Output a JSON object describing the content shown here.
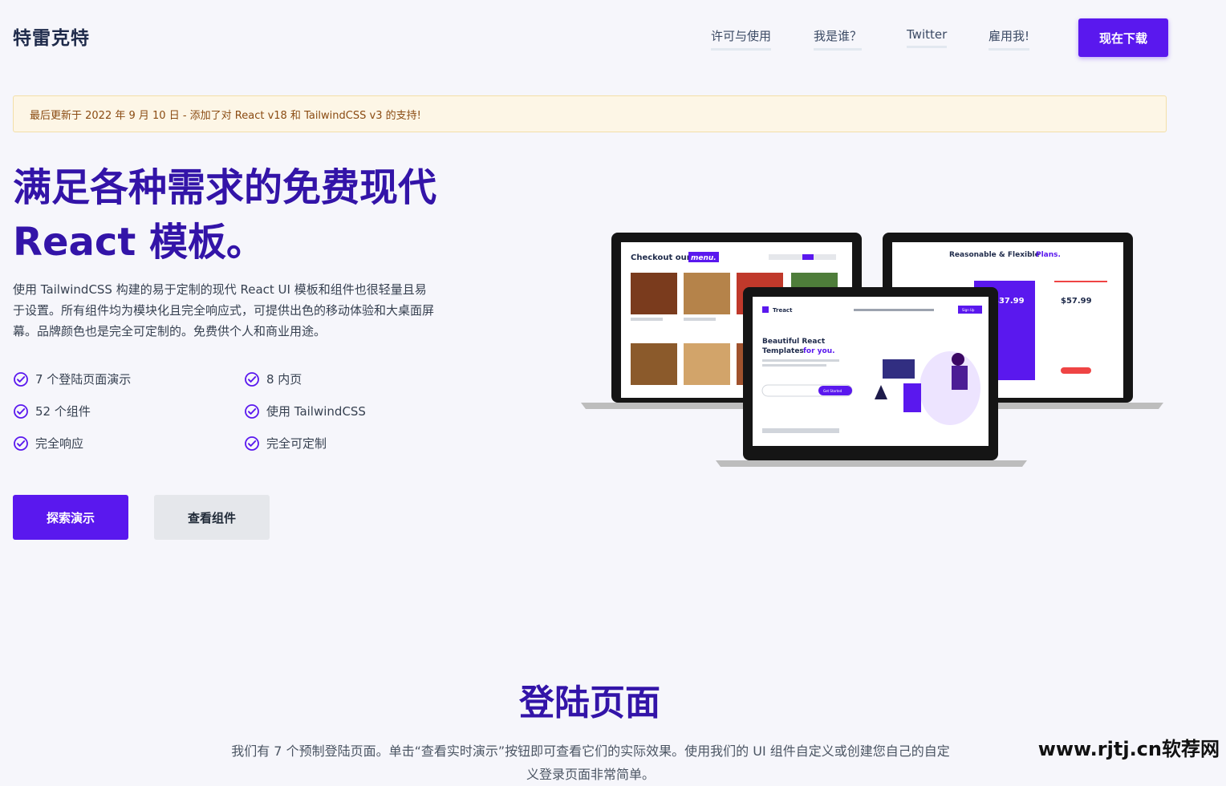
{
  "brand": "特雷克特",
  "nav": {
    "links": [
      "许可与使用",
      "我是谁？",
      "Twitter",
      "雇用我!"
    ],
    "cta": "现在下载"
  },
  "notice": "最后更新于 2022 年 9 月 10 日 - 添加了对 React v18 和 TailwindCSS v3 的支持!",
  "hero": {
    "title_line1": "满足各种需求的免费现代",
    "title_line2": "React 模板。",
    "description": "使用 TailwindCSS 构建的易于定制的现代 React UI 模板和组件也很轻量且易于设置。所有组件均为模块化且完全响应式，可提供出色的移动体验和大桌面屏幕。品牌颜色也是完全可定制的。免费供个人和商业用途。",
    "features": [
      "7 个登陆页面演示",
      "8 内页",
      "52 个组件",
      "使用 TailwindCSS",
      "完全响应",
      "完全可定制"
    ],
    "primary_button": "探索演示",
    "secondary_button": "查看组件"
  },
  "mockups": {
    "menu_title": "Checkout our",
    "menu_highlight": "menu.",
    "plans_title": "Reasonable & Flexible",
    "plans_highlight": "Plans.",
    "price_1": "$37.99",
    "price_2": "$57.99",
    "front_logo": "Treact",
    "front_heading_1": "Beautiful React",
    "front_heading_2": "Templates",
    "front_heading_highlight": "for you.",
    "front_button": "Get Started",
    "front_nav_button": "Sign Up",
    "accent": "#5a18ee"
  },
  "section": {
    "title": "登陆页面",
    "description": "我们有 7 个预制登陆页面。单击“查看实时演示”按钮即可查看它们的实际效果。使用我们的 UI 组件自定义或创建您自己的自定义登录页面非常简单。"
  },
  "watermark": "www.rjtj.cn软荐网",
  "colors": {
    "primary": "#5a18ee",
    "heading": "#3314a8",
    "notice_bg": "#fdf6e6",
    "notice_text": "#8a4b12"
  }
}
